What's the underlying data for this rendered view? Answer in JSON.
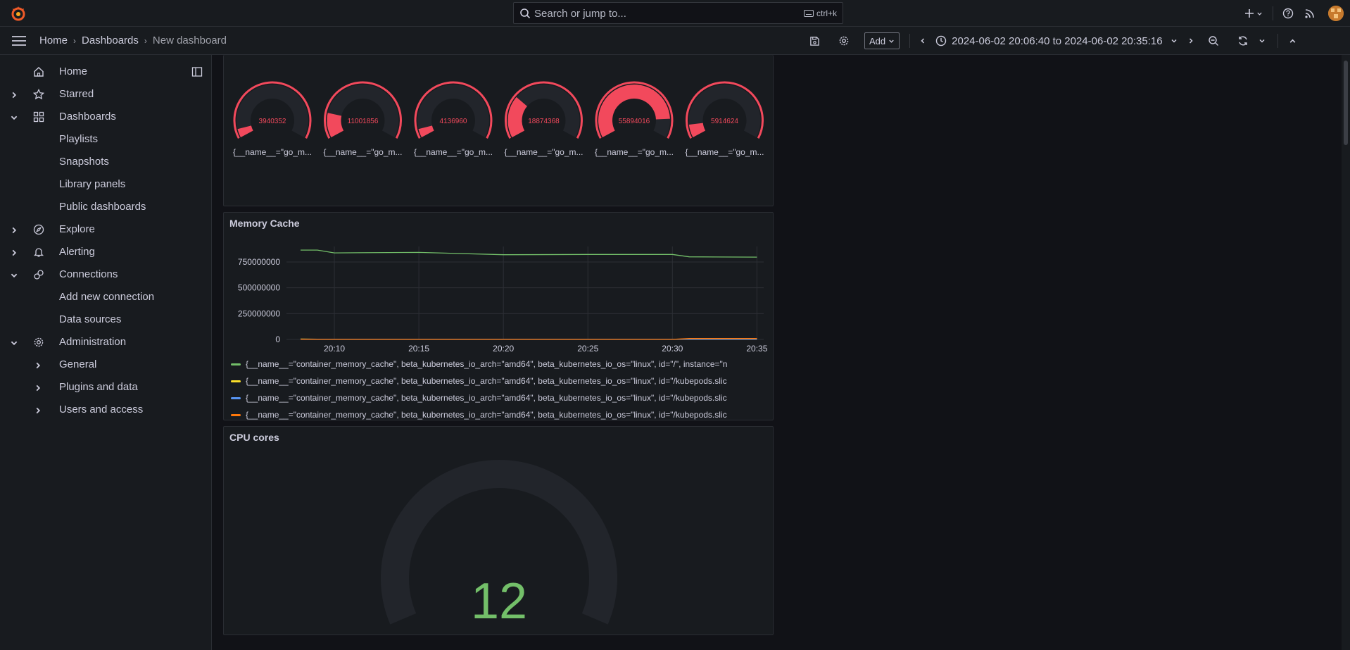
{
  "topbar": {
    "search_placeholder": "Search or jump to...",
    "search_shortcut": "ctrl+k"
  },
  "breadcrumbs": [
    "Home",
    "Dashboards",
    "New dashboard"
  ],
  "toolbar": {
    "add_label": "Add",
    "time_range": "2024-06-02 20:06:40 to 2024-06-02 20:35:16"
  },
  "sidebar": {
    "items": [
      {
        "label": "Home",
        "icon": "home-icon"
      },
      {
        "label": "Starred",
        "icon": "star-icon"
      },
      {
        "label": "Dashboards",
        "icon": "apps-icon"
      },
      {
        "label": "Playlists"
      },
      {
        "label": "Snapshots"
      },
      {
        "label": "Library panels"
      },
      {
        "label": "Public dashboards"
      },
      {
        "label": "Explore",
        "icon": "compass-icon"
      },
      {
        "label": "Alerting",
        "icon": "bell-icon"
      },
      {
        "label": "Connections",
        "icon": "link-icon"
      },
      {
        "label": "Add new connection"
      },
      {
        "label": "Data sources"
      },
      {
        "label": "Administration",
        "icon": "cog-icon"
      },
      {
        "label": "General"
      },
      {
        "label": "Plugins and data"
      },
      {
        "label": "Users and access"
      }
    ]
  },
  "gauges": {
    "values": [
      "3940352",
      "11001856",
      "4136960",
      "18874368",
      "55894016",
      "5914624"
    ],
    "fills": [
      0.06,
      0.17,
      0.06,
      0.29,
      0.87,
      0.09
    ],
    "labels": [
      "{__name__=\"go_m...",
      "{__name__=\"go_m...",
      "{__name__=\"go_m...",
      "{__name__=\"go_m...",
      "{__name__=\"go_m...",
      "{__name__=\"go_m..."
    ],
    "color": "#f2495c"
  },
  "memory_panel": {
    "title": "Memory Cache",
    "legend": [
      {
        "color": "#73bf69",
        "text": "{__name__=\"container_memory_cache\", beta_kubernetes_io_arch=\"amd64\", beta_kubernetes_io_os=\"linux\", id=\"/\", instance=\"n"
      },
      {
        "color": "#fade2a",
        "text": "{__name__=\"container_memory_cache\", beta_kubernetes_io_arch=\"amd64\", beta_kubernetes_io_os=\"linux\", id=\"/kubepods.slic"
      },
      {
        "color": "#5794f2",
        "text": "{__name__=\"container_memory_cache\", beta_kubernetes_io_arch=\"amd64\", beta_kubernetes_io_os=\"linux\", id=\"/kubepods.slic"
      },
      {
        "color": "#ff780a",
        "text": "{__name__=\"container_memory_cache\", beta_kubernetes_io_arch=\"amd64\", beta_kubernetes_io_os=\"linux\", id=\"/kubepods.slic"
      }
    ]
  },
  "cpu_panel": {
    "title": "CPU cores",
    "value": "12",
    "color": "#73bf69"
  },
  "chart_data": {
    "type": "line",
    "title": "Memory Cache",
    "xlabel": "",
    "ylabel": "",
    "x": [
      "20:08",
      "20:09",
      "20:10",
      "20:15",
      "20:20",
      "20:25",
      "20:30",
      "20:31",
      "20:35"
    ],
    "x_ticks": [
      "20:10",
      "20:15",
      "20:20",
      "20:25",
      "20:30",
      "20:35"
    ],
    "y_ticks": [
      "0",
      "250000000",
      "500000000",
      "750000000"
    ],
    "ylim": [
      0,
      900000000
    ],
    "series": [
      {
        "values": [
          865000000,
          865000000,
          838000000,
          843000000,
          820000000,
          823000000,
          823000000,
          800000000,
          797000000
        ],
        "color": "#73bf69"
      },
      {
        "values": [
          4000000,
          3000000,
          3000000,
          3000000,
          3000000,
          3000000,
          3000000,
          3000000,
          3000000
        ],
        "color": "#fade2a"
      },
      {
        "values": [
          2000000,
          2000000,
          2000000,
          2000000,
          2000000,
          2000000,
          2000000,
          2000000,
          2000000
        ],
        "color": "#5794f2"
      },
      {
        "values": [
          1000000,
          1000000,
          1000000,
          1000000,
          1000000,
          1000000,
          1000000,
          9000000,
          9000000
        ],
        "color": "#ff780a"
      }
    ],
    "grid": true,
    "legend": "bottom"
  }
}
